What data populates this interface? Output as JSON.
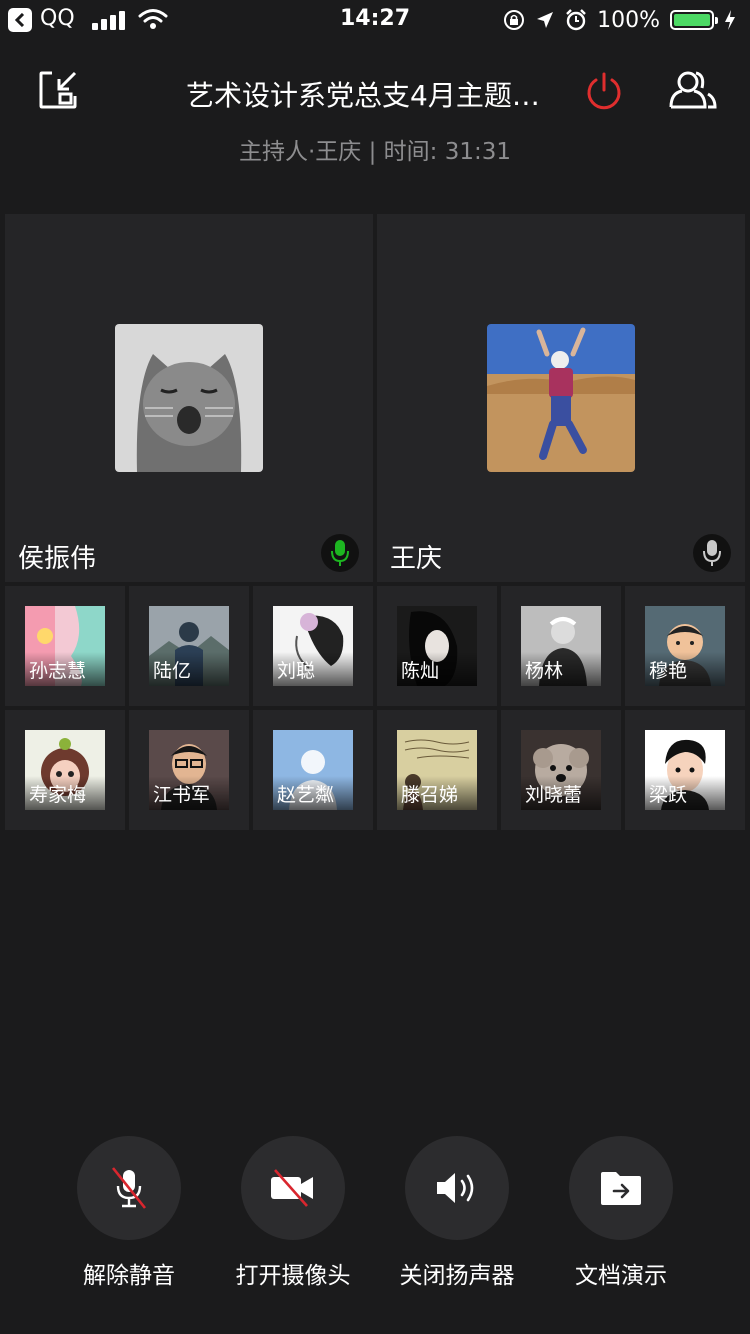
{
  "status_bar": {
    "back_app": "QQ",
    "time": "14:27",
    "battery": "100%"
  },
  "header": {
    "title": "艺术设计系党总支4月主题…",
    "host_info": "主持人·王庆 | 时间: 31:31"
  },
  "video_tiles": [
    {
      "name": "侯振伟",
      "mic_state": "speaking",
      "mic_color": "#1db521"
    },
    {
      "name": "王庆",
      "mic_state": "idle",
      "mic_color": "#c9c9c9"
    }
  ],
  "participants": [
    {
      "name": "孙志慧"
    },
    {
      "name": "陆亿"
    },
    {
      "name": "刘聪"
    },
    {
      "name": "陈灿"
    },
    {
      "name": "杨林"
    },
    {
      "name": "穆艳"
    },
    {
      "name": "寿家梅"
    },
    {
      "name": "江书军"
    },
    {
      "name": "赵艺粼"
    },
    {
      "name": "滕召娣"
    },
    {
      "name": "刘晓蕾"
    },
    {
      "name": "梁跃"
    }
  ],
  "controls": {
    "unmute_label": "解除静音",
    "camera_label": "打开摄像头",
    "speaker_label": "关闭扬声器",
    "share_doc_label": "文档演示"
  },
  "colors": {
    "background": "#1b1b1c",
    "tile": "#252527",
    "end_meeting": "#e02e2e",
    "mute_slash": "#d9262e"
  }
}
